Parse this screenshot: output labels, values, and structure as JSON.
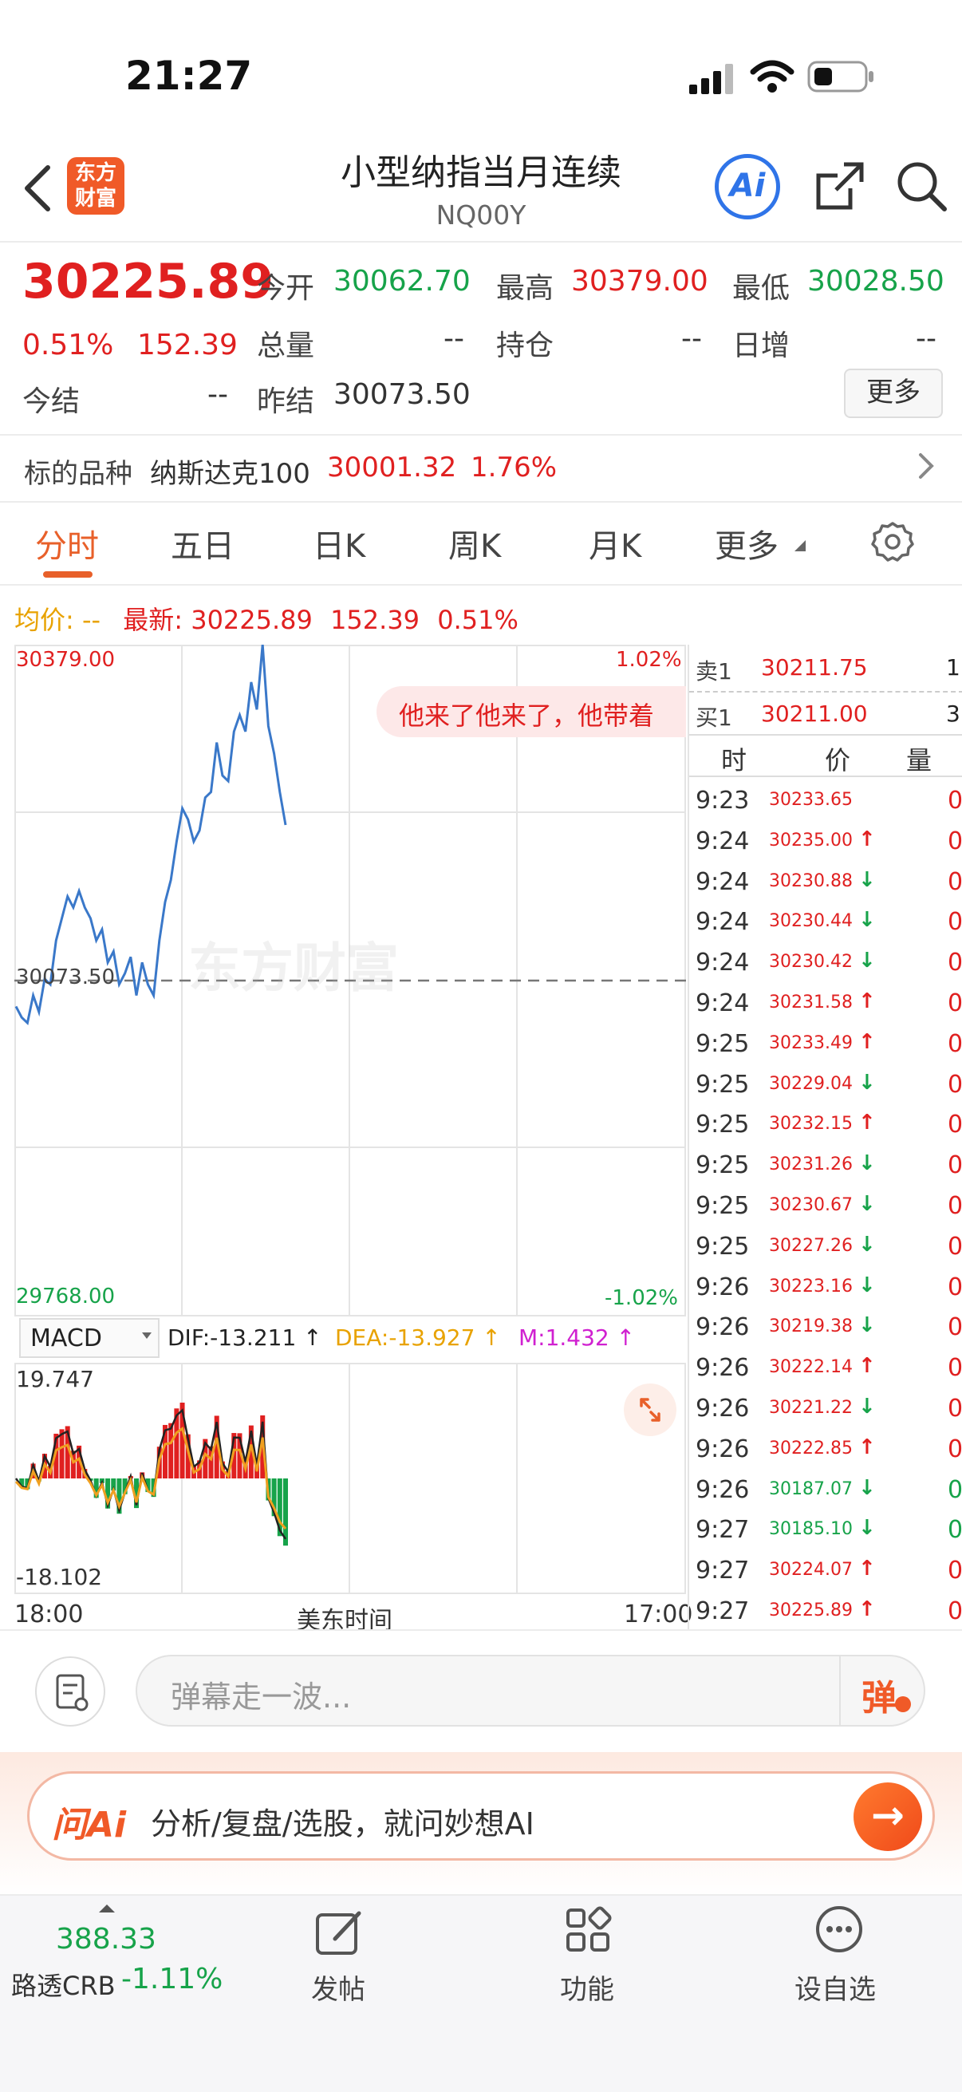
{
  "status": {
    "time": "21:27"
  },
  "header": {
    "logo_text_1": "东方",
    "logo_text_2": "财富",
    "title": "小型纳指当月连续",
    "code": "NQ00Y",
    "ai_label": "Ai"
  },
  "quote": {
    "price": "30225.89",
    "change_pct": "0.51%",
    "change": "152.39",
    "open_label": "今开",
    "open": "30062.70",
    "high_label": "最高",
    "high": "30379.00",
    "low_label": "最低",
    "low": "30028.50",
    "volume_label": "总量",
    "volume": "--",
    "position_label": "持仓",
    "position": "--",
    "daily_inc_label": "日增",
    "daily_inc": "--",
    "settle_label": "今结",
    "settle": "--",
    "prev_settle_label": "昨结",
    "prev_settle": "30073.50",
    "more_label": "更多"
  },
  "underlying": {
    "label": "标的品种",
    "name": "纳斯达克100",
    "price": "30001.32",
    "pct": "1.76%"
  },
  "tabs": [
    "分时",
    "五日",
    "日K",
    "周K",
    "月K",
    "更多"
  ],
  "chart": {
    "avg_label": "均价:",
    "avg_value": "--",
    "latest_label": "最新:",
    "latest_value": "30225.89",
    "latest_change": "152.39",
    "latest_pct": "0.51%",
    "y_top": "30379.00",
    "y_mid": "30073.50",
    "y_bottom": "29768.00",
    "pct_top": "1.02%",
    "pct_bottom": "-1.02%",
    "watermark": "东方财富",
    "danmaku": "他来了他来了，他带着",
    "macd_label": "MACD",
    "dif": "DIF:-13.211 ↑",
    "dea": "DEA:-13.927 ↑",
    "m": "M:1.432 ↑",
    "macd_top": "19.747",
    "macd_bottom": "-18.102",
    "x_start": "18:00",
    "x_mid": "美东时间",
    "x_end": "17:00"
  },
  "chart_data": {
    "type": "line",
    "ylim": [
      29768.0,
      30379.0
    ],
    "prev_settle": 30073.5,
    "x_labels": [
      "18:00",
      "美东时间",
      "17:00"
    ],
    "series": [
      {
        "values": [
          30050,
          30040,
          30035,
          30060,
          30045,
          30075,
          30070,
          30110,
          30130,
          30150,
          30140,
          30155,
          30140,
          30130,
          30110,
          30120,
          30090,
          30100,
          30070,
          30080,
          30095,
          30060,
          30090,
          30070,
          30060,
          30110,
          30145,
          30165,
          30200,
          30230,
          30220,
          30200,
          30210,
          30240,
          30245,
          30290,
          30260,
          30255,
          30300,
          30315,
          30300,
          30345,
          30320,
          30379,
          30305,
          30280,
          30245,
          30215
        ]
      }
    ]
  },
  "orderbook": {
    "sell_label": "卖1",
    "sell_price": "30211.75",
    "sell_qty": "1",
    "buy_label": "买1",
    "buy_price": "30211.00",
    "buy_qty": "3",
    "headers": [
      "时",
      "价",
      "量"
    ],
    "ticks": [
      {
        "t": "9:23",
        "p": "30233.65",
        "a": "",
        "q": "0",
        "c": "red"
      },
      {
        "t": "9:24",
        "p": "30235.00",
        "a": "↑",
        "q": "0",
        "c": "red"
      },
      {
        "t": "9:24",
        "p": "30230.88",
        "a": "↓",
        "q": "0",
        "c": "red"
      },
      {
        "t": "9:24",
        "p": "30230.44",
        "a": "↓",
        "q": "0",
        "c": "red"
      },
      {
        "t": "9:24",
        "p": "30230.42",
        "a": "↓",
        "q": "0",
        "c": "red"
      },
      {
        "t": "9:24",
        "p": "30231.58",
        "a": "↑",
        "q": "0",
        "c": "red"
      },
      {
        "t": "9:25",
        "p": "30233.49",
        "a": "↑",
        "q": "0",
        "c": "red"
      },
      {
        "t": "9:25",
        "p": "30229.04",
        "a": "↓",
        "q": "0",
        "c": "red"
      },
      {
        "t": "9:25",
        "p": "30232.15",
        "a": "↑",
        "q": "0",
        "c": "red"
      },
      {
        "t": "9:25",
        "p": "30231.26",
        "a": "↓",
        "q": "0",
        "c": "red"
      },
      {
        "t": "9:25",
        "p": "30230.67",
        "a": "↓",
        "q": "0",
        "c": "red"
      },
      {
        "t": "9:25",
        "p": "30227.26",
        "a": "↓",
        "q": "0",
        "c": "red"
      },
      {
        "t": "9:26",
        "p": "30223.16",
        "a": "↓",
        "q": "0",
        "c": "red"
      },
      {
        "t": "9:26",
        "p": "30219.38",
        "a": "↓",
        "q": "0",
        "c": "red"
      },
      {
        "t": "9:26",
        "p": "30222.14",
        "a": "↑",
        "q": "0",
        "c": "red"
      },
      {
        "t": "9:26",
        "p": "30221.22",
        "a": "↓",
        "q": "0",
        "c": "red"
      },
      {
        "t": "9:26",
        "p": "30222.85",
        "a": "↑",
        "q": "0",
        "c": "red"
      },
      {
        "t": "9:26",
        "p": "30187.07",
        "a": "↓",
        "q": "0",
        "c": "green"
      },
      {
        "t": "9:27",
        "p": "30185.10",
        "a": "↓",
        "q": "0",
        "c": "green"
      },
      {
        "t": "9:27",
        "p": "30224.07",
        "a": "↑",
        "q": "0",
        "c": "red"
      },
      {
        "t": "9:27",
        "p": "30225.89",
        "a": "↑",
        "q": "0",
        "c": "red"
      }
    ]
  },
  "comment": {
    "placeholder": "弹幕走一波...",
    "danmaku_btn": "弹"
  },
  "ai_bar": {
    "brand": "问Ai",
    "text": "分析/复盘/选股，就问妙想AI"
  },
  "bottom_nav": {
    "index_value": "388.33",
    "index_name": "路透CRB",
    "index_pct": "-1.11%",
    "post_label": "发帖",
    "func_label": "功能",
    "watch_label": "设自选"
  }
}
